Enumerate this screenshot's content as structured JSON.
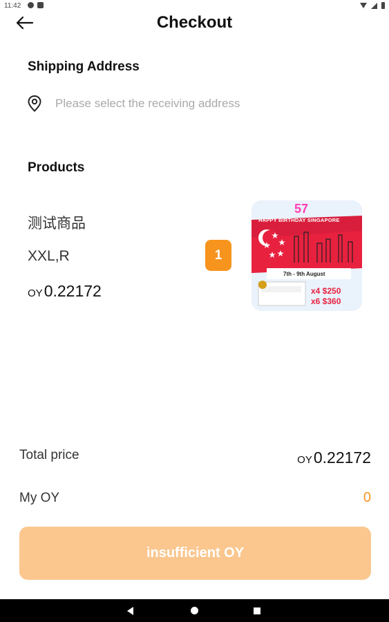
{
  "status_bar": {
    "time": "11:42",
    "icons": [
      "notification-icon",
      "notification-icon",
      "wifi-icon",
      "signal-icon",
      "battery-icon"
    ]
  },
  "header": {
    "title": "Checkout",
    "back_icon": "arrow-left-icon"
  },
  "shipping": {
    "title": "Shipping Address",
    "icon": "location-pin-icon",
    "placeholder": "Please select the receiving address"
  },
  "products": {
    "title": "Products",
    "items": [
      {
        "name": "测试商品",
        "spec": "XXL,R",
        "currency": "OY",
        "price": "0.22172",
        "quantity": "1",
        "image": {
          "headline": "57",
          "subtitle": "HAPPY BIRTHDAY SINGAPORE",
          "date": "7th - 9th August",
          "deals": [
            "x4 $250",
            "x6 $360"
          ]
        }
      }
    ]
  },
  "summary": {
    "total_label": "Total price",
    "total_currency": "OY",
    "total_value": "0.22172",
    "balance_label": "My OY",
    "balance_value": "0"
  },
  "action": {
    "label": "insufficient OY"
  },
  "colors": {
    "accent": "#f7941d",
    "button_disabled": "#fbc78f",
    "placeholder": "#a9a9a9",
    "nav_bar": "#000000"
  }
}
